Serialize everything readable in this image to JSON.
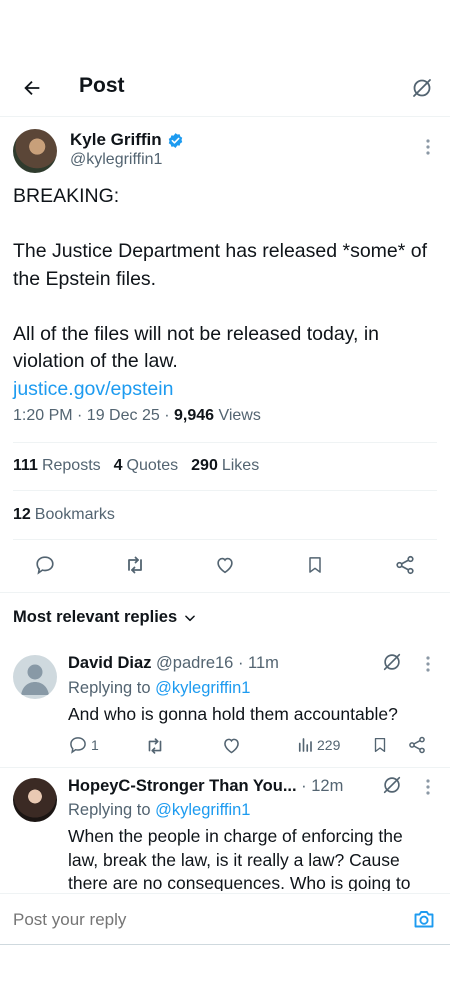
{
  "header": {
    "title": "Post"
  },
  "post": {
    "author_name": "Kyle Griffin",
    "author_handle": "@kylegriffin1",
    "lines": [
      "BREAKING:",
      "",
      "The Justice Department has released *some* of the Epstein files.",
      "",
      "All of the files will not be released today, in violation of the law."
    ],
    "link": "justice.gov/epstein",
    "time": "1:20 PM · 19 Dec 25 · ",
    "views_count": "9,946",
    "views_label": " Views",
    "reposts_count": "111",
    "reposts_label": "Reposts",
    "quotes_count": "4",
    "quotes_label": "Quotes",
    "likes_count": "290",
    "likes_label": "Likes",
    "bookmarks_count": "12",
    "bookmarks_label": "Bookmarks"
  },
  "replies_section": {
    "title": "Most relevant replies"
  },
  "replies": [
    {
      "name": "David Diaz",
      "handle": "@padre16",
      "time": " · 11m",
      "replying_prefix": "Replying to ",
      "replying_handle": "@kylegriffin1",
      "text": "And who is gonna hold them accountable?",
      "reply_count": "1",
      "views": "229"
    },
    {
      "name": "HopeyC-Stronger Than You...",
      "time": " · 12m",
      "replying_prefix": "Replying to ",
      "replying_handle": "@kylegriffin1",
      "text": "When the people in charge of enforcing the law, break the law, is it really a law? Cause there are no consequences. Who is going to"
    }
  ],
  "composer": {
    "placeholder": "Post your reply"
  },
  "colors": {
    "accent": "#1d9bf0",
    "secondary_text": "#536471",
    "border": "#eff3f4"
  }
}
